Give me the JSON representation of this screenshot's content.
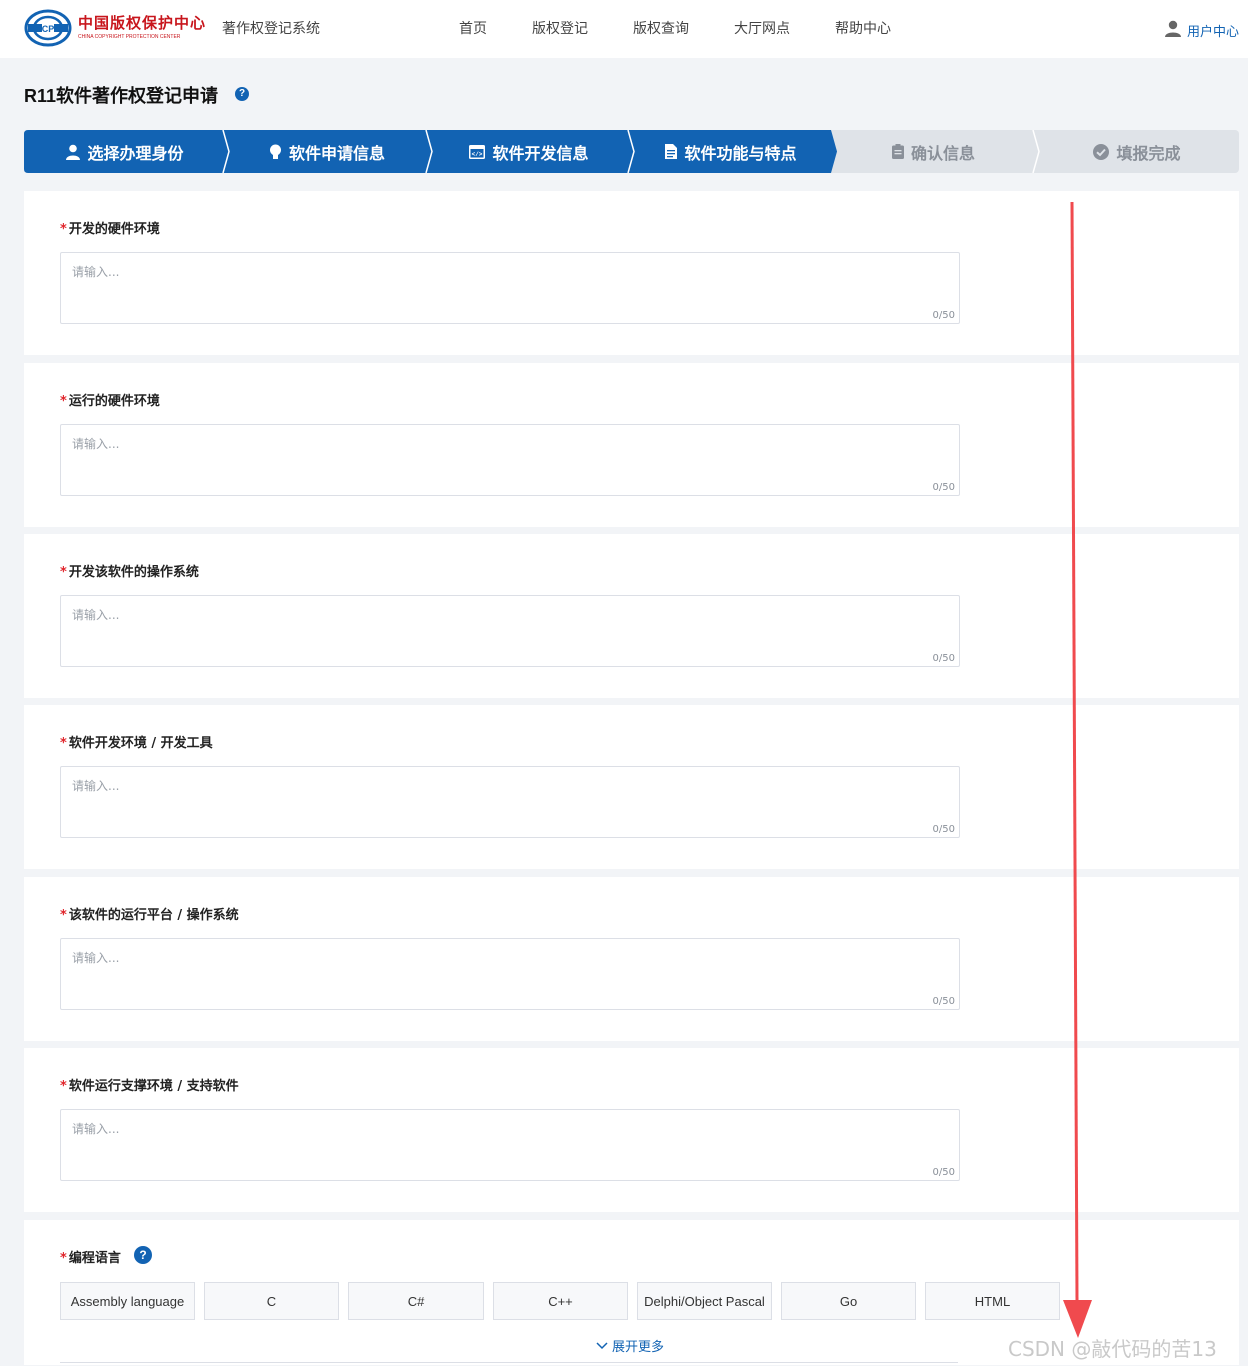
{
  "header": {
    "logo_cn": "中国版权保护中心",
    "logo_en": "CHINA COPYRIGHT PROTECTION CENTER",
    "system_name": "著作权登记系统",
    "nav": [
      "首页",
      "版权登记",
      "版权查询",
      "大厅网点",
      "帮助中心"
    ],
    "user_center": "用户中心"
  },
  "page": {
    "title": "R11软件著作权登记申请",
    "help": "?"
  },
  "steps": [
    {
      "label": "选择办理身份",
      "icon": "user-icon",
      "active": true
    },
    {
      "label": "软件申请信息",
      "icon": "lightbulb-icon",
      "active": true
    },
    {
      "label": "软件开发信息",
      "icon": "code-window-icon",
      "active": true
    },
    {
      "label": "软件功能与特点",
      "icon": "document-icon",
      "active": true
    },
    {
      "label": "确认信息",
      "icon": "clipboard-icon",
      "active": false
    },
    {
      "label": "填报完成",
      "icon": "check-circle-icon",
      "active": false
    }
  ],
  "fields": [
    {
      "label": "开发的硬件环境",
      "placeholder": "请输入...",
      "count": "0/50"
    },
    {
      "label": "运行的硬件环境",
      "placeholder": "请输入...",
      "count": "0/50"
    },
    {
      "label": "开发该软件的操作系统",
      "placeholder": "请输入...",
      "count": "0/50"
    },
    {
      "label": "软件开发环境 / 开发工具",
      "placeholder": "请输入...",
      "count": "0/50"
    },
    {
      "label": "该软件的运行平台 / 操作系统",
      "placeholder": "请输入...",
      "count": "0/50"
    },
    {
      "label": "软件运行支撑环境 / 支持软件",
      "placeholder": "请输入...",
      "count": "0/50"
    }
  ],
  "languages": {
    "label": "编程语言",
    "help": "?",
    "options": [
      "Assembly language",
      "C",
      "C#",
      "C++",
      "Delphi/Object Pascal",
      "Go",
      "HTML"
    ],
    "expand": "展开更多"
  },
  "required_mark": "*",
  "watermark": "CSDN @敲代码的苦13",
  "colors": {
    "primary": "#1263b3",
    "required": "#e0252b",
    "step_inactive": "#dfe3e8",
    "annotation_arrow": "#f04a4e"
  }
}
